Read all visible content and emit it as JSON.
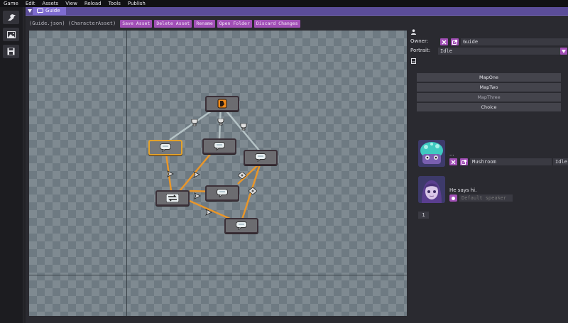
{
  "menubar": {
    "items": [
      "Game",
      "Edit",
      "Assets",
      "View",
      "Reload",
      "Tools",
      "Publish"
    ]
  },
  "sidebar": {
    "buttons": [
      "bird-icon",
      "image-icon",
      "save-icon"
    ]
  },
  "window": {
    "tab_title": "Guide"
  },
  "toolbar": {
    "asset_path": "(Guide.json) (CharacterAsset)",
    "buttons": [
      "Save Asset",
      "Delete Asset",
      "Rename",
      "Open Folder",
      "Discard Changes"
    ]
  },
  "inspector": {
    "owner_label": "Owner:",
    "owner_value": "Guide",
    "portrait_label": "Portrait:",
    "portrait_value": "Idle",
    "maps": [
      "MapOne",
      "MapTwo",
      "MapThree",
      "Choice"
    ],
    "dialogue": [
      {
        "text": "...",
        "speaker_name": "Mushroom",
        "speaker_portrait": "Idle"
      },
      {
        "text": "He says hi.",
        "speaker_placeholder": "Default speaker"
      }
    ],
    "page_number": "1"
  },
  "colors": {
    "accent": "#a14fb6",
    "title_bar": "#5b4d99",
    "tab": "#7e6cd0",
    "selected_node": "#e3a22a",
    "edge_orange": "#e8962a",
    "edge_grey": "#b5c3c6"
  }
}
